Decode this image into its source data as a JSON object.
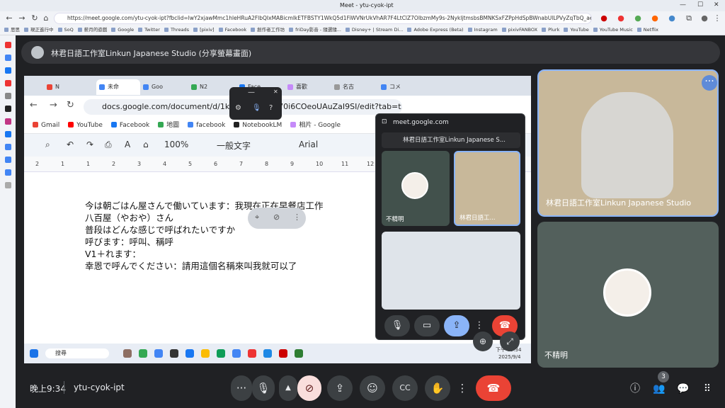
{
  "browser": {
    "window_title": "Meet - ytu-cyok-ipt",
    "url": "https://meet.google.com/ytu-cyok-ipt?fbclid=IwY2xjawMmc1hleHRuA2FlbQIxMABicmlkETFBSTY1WkQ5d1FiWVNrUkVhAR7F4LtClZ7OlbzmMy9s-2NykljtmsbsBMNKSxFZPpHdSpBWnabUlLPVyZqTbQ_aem_dy2Z7yqODR9gK8zEzX...",
    "bookmarks": [
      "思思",
      "現正進行中",
      "SoQ",
      "薪月的遊戲",
      "Google",
      "Twitter",
      "Threads",
      "[pixiv]",
      "Facebook",
      "創作者工作坊",
      "friDay影音 - 隨選隨...",
      "Disney+ | Stream Di...",
      "Adobe Express (Beta)",
      "Instagram",
      "pixivFANBOX",
      "Plurk",
      "YouTube",
      "YouTube Music",
      "Netflix"
    ]
  },
  "meet": {
    "presenter_title": "林君日語工作室Linkun Japanese Studio (分享螢幕畫面)",
    "time": "晚上9:34",
    "meeting_code": "ytu-cyok-ipt",
    "participant_count": "3",
    "tiles": [
      {
        "name": "林君日語工作室Linkun Japanese Studio"
      },
      {
        "name": "不精明"
      }
    ]
  },
  "shared": {
    "tabs": [
      "N",
      "未命",
      "Goo",
      "N2",
      "Face",
      "喜歡",
      "名古",
      "コメ"
    ],
    "doc_url": "docs.google.com/document/d/1ka75j...OQlpA70i6COeoUAuZaI9SI/edit?tab=t.0",
    "bookmarks": [
      "Gmail",
      "YouTube",
      "Facebook",
      "地圖",
      "facebook",
      "NotebookLM",
      "相片 - Google"
    ],
    "zoom": "100%",
    "style": "一般文字",
    "font": "Arial",
    "ruler": [
      "2",
      "1",
      "1",
      "2",
      "3",
      "4",
      "5",
      "6",
      "7",
      "8",
      "9",
      "10",
      "11",
      "12"
    ],
    "lines": [
      "今は朝ごはん屋さんで働いています：我現在正在早餐店工作",
      "八百屋（やおや）さん",
      "普段はどんな感じで呼ばれたいですか",
      "呼びます：呼叫、稱呼",
      "V1＋れます：",
      "幸恩で呼んでください：請用這個名稱來叫我就可以了"
    ],
    "taskbar_search": "搜尋",
    "taskbar_time": "下午 09:34",
    "taskbar_date": "2025/9/4"
  },
  "pip": {
    "url": "meet.google.com",
    "header": "林君日語工作室Linkun Japanese S...",
    "tile_a": "不精明",
    "tile_b": "林君日語工..."
  },
  "colors": {
    "bg": "#202124",
    "end_call": "#ea4335",
    "active_blue": "#8ab4f8",
    "cam_off": "#f9dedc"
  }
}
